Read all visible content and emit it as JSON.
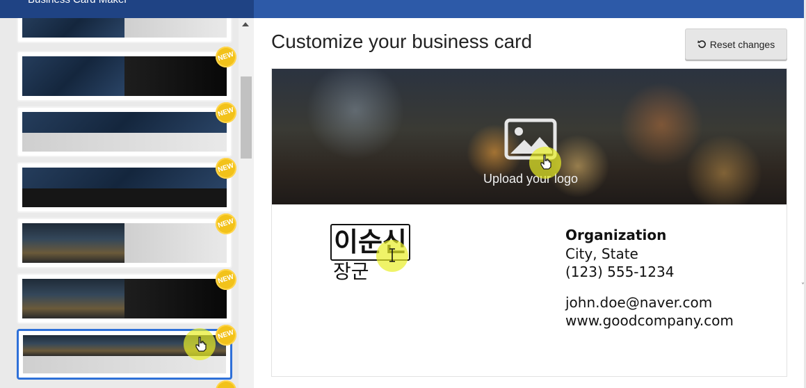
{
  "app": {
    "title": "Business Card Maker"
  },
  "header": {
    "title": "Customize your business card",
    "reset_label": "Reset changes"
  },
  "templates": [
    {
      "style": "space-grey",
      "badge": ""
    },
    {
      "style": "space-black",
      "badge": "NEW"
    },
    {
      "style": "space-strip-grey",
      "badge": "NEW"
    },
    {
      "style": "space-strip-dark",
      "badge": "NEW"
    },
    {
      "style": "city-grey",
      "badge": "NEW"
    },
    {
      "style": "city-black",
      "badge": "NEW"
    },
    {
      "style": "city-strip-grey",
      "badge": "NEW",
      "selected": true
    }
  ],
  "card": {
    "upload_label": "Upload your logo",
    "name": "이순신",
    "title": "장군",
    "organization": "Organization",
    "city_state": "City, State",
    "phone": "(123) 555-1234",
    "email": "john.doe@naver.com",
    "website": "www.goodcompany.com"
  },
  "colors": {
    "accent": "#2e70d8",
    "badge": "#f2c21a",
    "topbar": "#2d5aa8"
  }
}
